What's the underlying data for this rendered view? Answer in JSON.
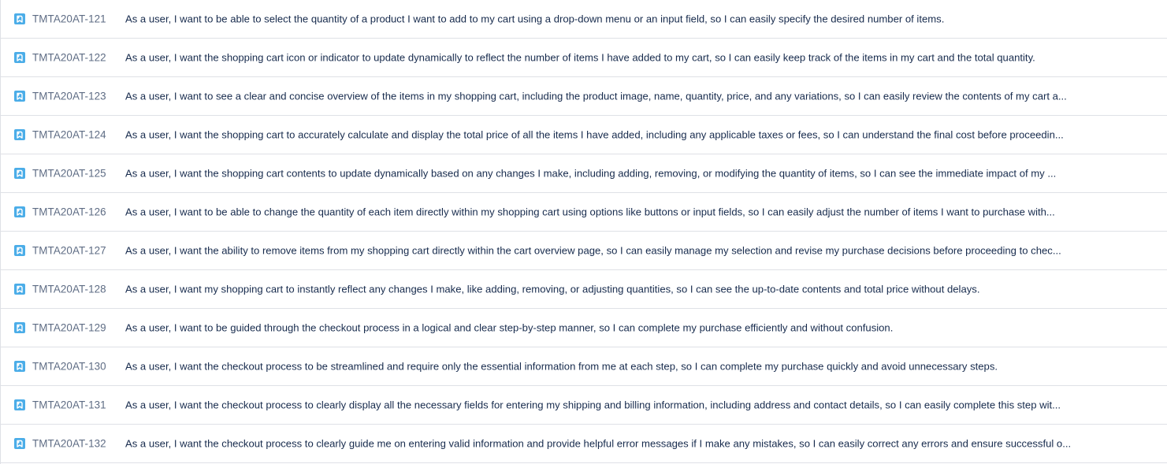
{
  "issues": {
    "accent_color": "#4bade8",
    "icon_name": "story-icon",
    "rows": [
      {
        "key": "TMTA20AT-121",
        "summary": "As a user, I want to be able to select the quantity of a product I want to add to my cart using a drop-down menu or an input field, so I can easily specify the desired number of items."
      },
      {
        "key": "TMTA20AT-122",
        "summary": "As a user, I want the shopping cart icon or indicator to update dynamically to reflect the number of items I have added to my cart, so I can easily keep track of the items in my cart and the total quantity."
      },
      {
        "key": "TMTA20AT-123",
        "summary": "As a user, I want to see a clear and concise overview of the items in my shopping cart, including the product image, name, quantity, price, and any variations, so I can easily review the contents of my cart a..."
      },
      {
        "key": "TMTA20AT-124",
        "summary": "As a user, I want the shopping cart to accurately calculate and display the total price of all the items I have added, including any applicable taxes or fees, so I can understand the final cost before proceedin..."
      },
      {
        "key": "TMTA20AT-125",
        "summary": "As a user, I want the shopping cart contents to update dynamically based on any changes I make, including adding, removing, or modifying the quantity of items, so I can see the immediate impact of my ..."
      },
      {
        "key": "TMTA20AT-126",
        "summary": "As a user, I want to be able to change the quantity of each item directly within my shopping cart using options like buttons or input fields, so I can easily adjust the number of items I want to purchase with..."
      },
      {
        "key": "TMTA20AT-127",
        "summary": "As a user, I want the ability to remove items from my shopping cart directly within the cart overview page, so I can easily manage my selection and revise my purchase decisions before proceeding to chec..."
      },
      {
        "key": "TMTA20AT-128",
        "summary": "As a user, I want my shopping cart to instantly reflect any changes I make, like adding, removing, or adjusting quantities, so I can see the up-to-date contents and total price without delays."
      },
      {
        "key": "TMTA20AT-129",
        "summary": "As a user, I want to be guided through the checkout process in a logical and clear step-by-step manner, so I can complete my purchase efficiently and without confusion."
      },
      {
        "key": "TMTA20AT-130",
        "summary": "As a user, I want the checkout process to be streamlined and require only the essential information from me at each step, so I can complete my purchase quickly and avoid unnecessary steps."
      },
      {
        "key": "TMTA20AT-131",
        "summary": "As a user, I want the checkout process to clearly display all the necessary fields for entering my shipping and billing information, including address and contact details, so I can easily complete this step wit..."
      },
      {
        "key": "TMTA20AT-132",
        "summary": "As a user, I want the checkout process to clearly guide me on entering valid information and provide helpful error messages if I make any mistakes, so I can easily correct any errors and ensure successful o..."
      }
    ]
  }
}
